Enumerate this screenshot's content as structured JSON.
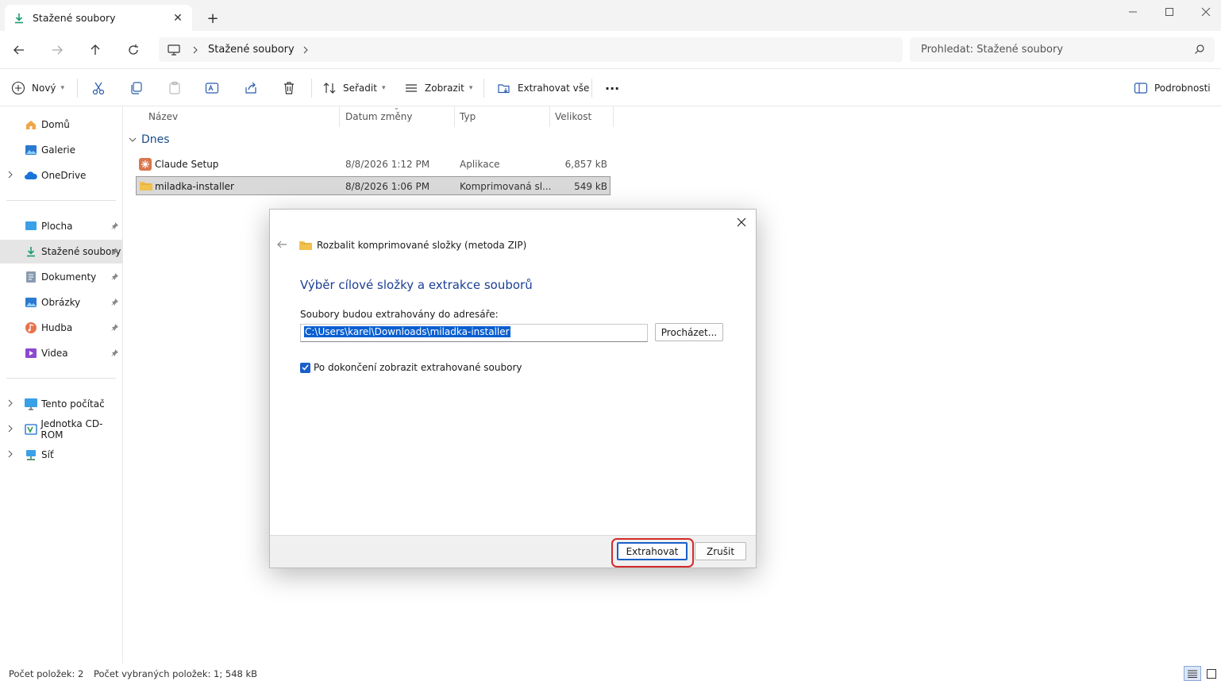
{
  "tab": {
    "title": "Stažené soubory",
    "close": "✕",
    "new": "+"
  },
  "window": {
    "minimize": "—",
    "maximize": "☐",
    "close": "✕"
  },
  "address": {
    "crumb": "Stažené soubory"
  },
  "search": {
    "placeholder": "Prohledat: Stažené soubory"
  },
  "toolbar": {
    "new": "Nový",
    "sort": "Seřadit",
    "view": "Zobrazit",
    "extract_all": "Extrahovat vše",
    "more": "···",
    "details": "Podrobnosti"
  },
  "sidebar": {
    "items": [
      {
        "label": "Domů",
        "icon": "home-icon"
      },
      {
        "label": "Galerie",
        "icon": "gallery-icon"
      },
      {
        "label": "OneDrive",
        "icon": "cloud-icon"
      },
      {
        "label": "Plocha",
        "icon": "desktop-icon"
      },
      {
        "label": "Stažené soubory",
        "icon": "download-icon"
      },
      {
        "label": "Dokumenty",
        "icon": "documents-icon"
      },
      {
        "label": "Obrázky",
        "icon": "pictures-icon"
      },
      {
        "label": "Hudba",
        "icon": "music-icon"
      },
      {
        "label": "Videa",
        "icon": "videos-icon"
      },
      {
        "label": "Tento počítač",
        "icon": "computer-icon"
      },
      {
        "label": "Jednotka CD-ROM",
        "icon": "cdrom-icon"
      },
      {
        "label": "Síť",
        "icon": "network-icon"
      }
    ]
  },
  "columns": {
    "name": "Název",
    "date": "Datum změny",
    "type": "Typ",
    "size": "Velikost"
  },
  "group": {
    "label": "Dnes"
  },
  "files": [
    {
      "name": "Claude Setup",
      "date": "8/8/2026 1:12 PM",
      "type": "Aplikace",
      "size": "6,857 kB"
    },
    {
      "name": "miladka-installer",
      "date": "8/8/2026 1:06 PM",
      "type": "Komprimovaná sl...",
      "size": "549 kB"
    }
  ],
  "status": {
    "count": "Počet položek: 2",
    "selected": "Počet vybraných položek: 1; 548 kB"
  },
  "dialog": {
    "title": "Rozbalit komprimované složky (metoda ZIP)",
    "heading": "Výběr cílové složky a extrakce souborů",
    "label": "Soubory budou extrahovány do adresáře:",
    "path": "C:\\Users\\karel\\Downloads\\miladka-installer",
    "browse": "Procházet...",
    "checkbox": "Po dokončení zobrazit extrahované soubory",
    "extract": "Extrahovat",
    "cancel": "Zrušit"
  },
  "colors": {
    "accent": "#0a5fd0",
    "heading": "#1c3f94",
    "highlight": "#d42a2a"
  }
}
